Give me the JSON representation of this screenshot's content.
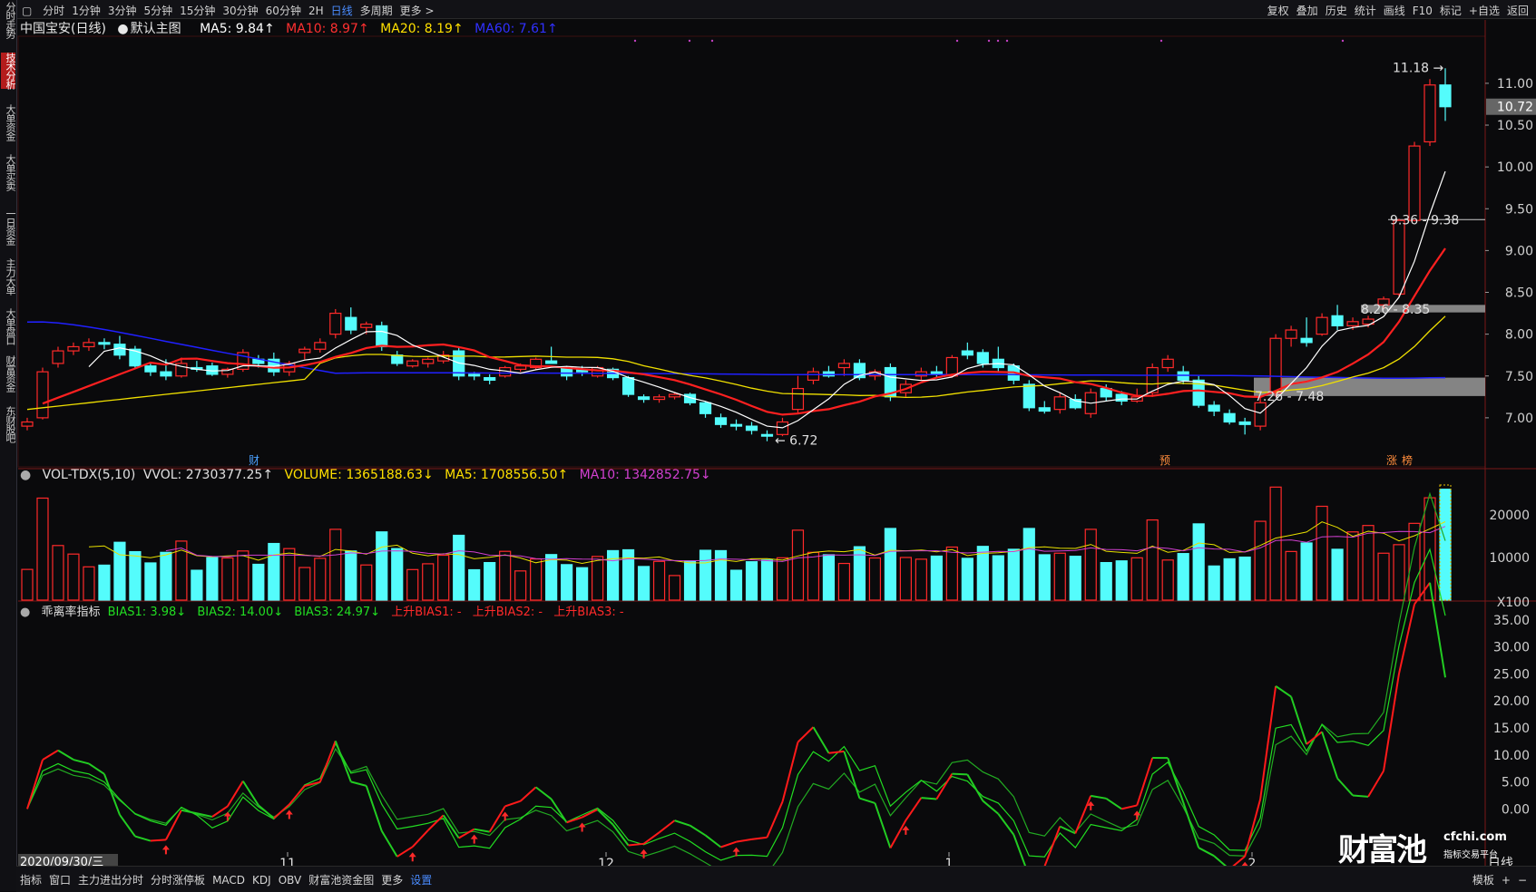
{
  "toolbar": {
    "left": [
      "分时",
      "1分钟",
      "3分钟",
      "5分钟",
      "15分钟",
      "30分钟",
      "60分钟",
      "2H",
      "日线",
      "多周期",
      "更多 >"
    ],
    "active": "日线",
    "right": [
      "复权",
      "叠加",
      "历史",
      "统计",
      "画线",
      "F10",
      "标记",
      "+自选",
      "返回"
    ]
  },
  "sidebar": [
    {
      "label": "分时走势",
      "active": false
    },
    {
      "label": "技术分析",
      "active": true
    },
    {
      "label": "大单资金",
      "active": false
    },
    {
      "label": "大单买卖",
      "active": false
    },
    {
      "label": "一日资金",
      "active": false
    },
    {
      "label": "主力大单",
      "active": false
    },
    {
      "label": "大单盘口",
      "active": false
    },
    {
      "label": "财富资金",
      "active": false
    },
    {
      "label": "东财股吧",
      "active": false
    }
  ],
  "main_legend": {
    "stock": "中国宝安(日线)",
    "template": "默认主图",
    "ma5": "MA5: 9.84↑",
    "ma10": "MA10: 8.97↑",
    "ma20": "MA20: 8.19↑",
    "ma60": "MA60: 7.61↑"
  },
  "vol_legend": {
    "name": "VOL-TDX(5,10)",
    "vvol": "VVOL: 2730377.25↑",
    "volume": "VOLUME: 1365188.63↓",
    "ma5": "MA5: 1708556.50↑",
    "ma10": "MA10: 1342852.75↓"
  },
  "bias_legend": {
    "name": "乖离率指标",
    "bias1": "BIAS1: 3.98↓",
    "bias2": "BIAS2: 14.00↓",
    "bias3": "BIAS3: 24.97↓",
    "up1": "上升BIAS1: -",
    "up2": "上升BIAS2: -",
    "up3": "上升BIAS3: -"
  },
  "price_axis": [
    "11.00",
    "10.50",
    "10.00",
    "9.50",
    "9.00",
    "8.50",
    "8.00",
    "7.50",
    "7.00"
  ],
  "current_price": "10.72",
  "vol_axis": [
    "20000",
    "10000",
    "X100"
  ],
  "bias_axis": [
    "35.00",
    "30.00",
    "25.00",
    "20.00",
    "15.00",
    "10.00",
    "5.00",
    "0.00"
  ],
  "annotations": {
    "high": "11.18",
    "low": "6.72",
    "range1": "9.36 - 9.38",
    "range2": "8.26 - 8.35",
    "range3": "7.26 - 7.48",
    "marker_cai": "财",
    "marker_yu": "预",
    "marker_zhang": "涨",
    "marker_bang": "榜"
  },
  "date_axis": {
    "cursor_date": "2020/09/30/三",
    "months": [
      "11",
      "12",
      "1",
      "2"
    ],
    "period": "日线"
  },
  "bottom_tabs": [
    "指标",
    "窗口",
    "主力进出分时",
    "分时涨停板",
    "MACD",
    "KDJ",
    "OBV",
    "财富池资金图",
    "更多",
    "设置"
  ],
  "bottom_right": [
    "模板",
    "+",
    "−"
  ],
  "watermark": {
    "brand": "财富池",
    "site": "cfchi.com",
    "tagline": "指标交易平台"
  },
  "colors": {
    "up": "#ff2a2a",
    "down": "#54fcfc",
    "ma5": "#ffffff",
    "ma10": "#ff2020",
    "ma20": "#f0e000",
    "ma60": "#2020ff",
    "bias1": "#ff1a1a",
    "bias2": "#22dd22",
    "bias3": "#22aa22",
    "vol_ma10": "#d040d0"
  },
  "chart_data": {
    "type": "candlestick",
    "title": "中国宝安(日线)",
    "ylim": [
      6.5,
      11.4
    ],
    "candles": [
      [
        6.9,
        7.0,
        6.85,
        6.95
      ],
      [
        7.0,
        7.6,
        6.98,
        7.55
      ],
      [
        7.65,
        7.85,
        7.6,
        7.8
      ],
      [
        7.8,
        7.9,
        7.75,
        7.85
      ],
      [
        7.85,
        7.95,
        7.8,
        7.9
      ],
      [
        7.9,
        7.95,
        7.82,
        7.88
      ],
      [
        7.88,
        7.98,
        7.7,
        7.75
      ],
      [
        7.82,
        7.86,
        7.6,
        7.62
      ],
      [
        7.62,
        7.65,
        7.5,
        7.55
      ],
      [
        7.55,
        7.7,
        7.45,
        7.5
      ],
      [
        7.5,
        7.72,
        7.48,
        7.65
      ],
      [
        7.6,
        7.68,
        7.55,
        7.58
      ],
      [
        7.62,
        7.66,
        7.5,
        7.52
      ],
      [
        7.52,
        7.6,
        7.48,
        7.58
      ],
      [
        7.58,
        7.82,
        7.55,
        7.78
      ],
      [
        7.7,
        7.75,
        7.6,
        7.65
      ],
      [
        7.7,
        7.78,
        7.5,
        7.55
      ],
      [
        7.55,
        7.68,
        7.5,
        7.65
      ],
      [
        7.78,
        7.85,
        7.7,
        7.82
      ],
      [
        7.82,
        7.95,
        7.78,
        7.9
      ],
      [
        8.0,
        8.3,
        7.95,
        8.25
      ],
      [
        8.2,
        8.32,
        8.0,
        8.05
      ],
      [
        8.08,
        8.15,
        8.0,
        8.12
      ],
      [
        8.1,
        8.15,
        7.8,
        7.85
      ],
      [
        7.75,
        7.8,
        7.62,
        7.65
      ],
      [
        7.62,
        7.7,
        7.6,
        7.68
      ],
      [
        7.65,
        7.72,
        7.6,
        7.7
      ],
      [
        7.68,
        7.8,
        7.65,
        7.75
      ],
      [
        7.8,
        7.85,
        7.45,
        7.5
      ],
      [
        7.52,
        7.55,
        7.45,
        7.5
      ],
      [
        7.48,
        7.52,
        7.4,
        7.45
      ],
      [
        7.5,
        7.62,
        7.48,
        7.6
      ],
      [
        7.58,
        7.65,
        7.55,
        7.62
      ],
      [
        7.6,
        7.72,
        7.58,
        7.7
      ],
      [
        7.68,
        7.85,
        7.65,
        7.65
      ],
      [
        7.6,
        7.62,
        7.45,
        7.5
      ],
      [
        7.58,
        7.62,
        7.5,
        7.55
      ],
      [
        7.5,
        7.62,
        7.48,
        7.6
      ],
      [
        7.58,
        7.6,
        7.45,
        7.48
      ],
      [
        7.48,
        7.5,
        7.25,
        7.28
      ],
      [
        7.25,
        7.28,
        7.18,
        7.22
      ],
      [
        7.22,
        7.28,
        7.18,
        7.25
      ],
      [
        7.25,
        7.3,
        7.22,
        7.28
      ],
      [
        7.28,
        7.3,
        7.15,
        7.18
      ],
      [
        7.18,
        7.2,
        7.0,
        7.05
      ],
      [
        7.0,
        7.05,
        6.88,
        6.92
      ],
      [
        6.92,
        6.98,
        6.85,
        6.9
      ],
      [
        6.9,
        6.95,
        6.8,
        6.85
      ],
      [
        6.8,
        6.85,
        6.72,
        6.78
      ],
      [
        6.8,
        7.0,
        6.78,
        6.95
      ],
      [
        7.1,
        7.5,
        7.05,
        7.35
      ],
      [
        7.45,
        7.6,
        7.4,
        7.55
      ],
      [
        7.55,
        7.62,
        7.48,
        7.5
      ],
      [
        7.6,
        7.7,
        7.5,
        7.65
      ],
      [
        7.65,
        7.7,
        7.45,
        7.48
      ],
      [
        7.5,
        7.58,
        7.45,
        7.55
      ],
      [
        7.6,
        7.65,
        7.2,
        7.25
      ],
      [
        7.3,
        7.45,
        7.25,
        7.4
      ],
      [
        7.5,
        7.6,
        7.45,
        7.55
      ],
      [
        7.55,
        7.62,
        7.48,
        7.52
      ],
      [
        7.5,
        7.75,
        7.48,
        7.72
      ],
      [
        7.8,
        7.9,
        7.7,
        7.75
      ],
      [
        7.78,
        7.82,
        7.6,
        7.65
      ],
      [
        7.7,
        7.85,
        7.55,
        7.6
      ],
      [
        7.62,
        7.65,
        7.4,
        7.45
      ],
      [
        7.4,
        7.45,
        7.08,
        7.12
      ],
      [
        7.12,
        7.2,
        7.05,
        7.08
      ],
      [
        7.1,
        7.3,
        7.05,
        7.25
      ],
      [
        7.22,
        7.28,
        7.1,
        7.12
      ],
      [
        7.05,
        7.35,
        7.0,
        7.3
      ],
      [
        7.35,
        7.4,
        7.2,
        7.25
      ],
      [
        7.28,
        7.32,
        7.15,
        7.2
      ],
      [
        7.2,
        7.35,
        7.18,
        7.25
      ],
      [
        7.3,
        7.65,
        7.25,
        7.6
      ],
      [
        7.6,
        7.75,
        7.55,
        7.7
      ],
      [
        7.55,
        7.62,
        7.4,
        7.45
      ],
      [
        7.45,
        7.5,
        7.12,
        7.15
      ],
      [
        7.15,
        7.2,
        7.02,
        7.08
      ],
      [
        7.05,
        7.1,
        6.92,
        6.95
      ],
      [
        6.95,
        7.0,
        6.8,
        6.92
      ],
      [
        6.9,
        7.25,
        6.85,
        7.18
      ],
      [
        7.3,
        8.0,
        7.25,
        7.95
      ],
      [
        7.95,
        8.1,
        7.85,
        8.05
      ],
      [
        7.95,
        8.2,
        7.85,
        7.9
      ],
      [
        8.0,
        8.25,
        7.98,
        8.2
      ],
      [
        8.22,
        8.35,
        8.05,
        8.1
      ],
      [
        8.1,
        8.2,
        8.05,
        8.15
      ],
      [
        8.12,
        8.22,
        8.08,
        8.18
      ],
      [
        8.35,
        8.45,
        8.3,
        8.42
      ],
      [
        8.48,
        9.38,
        8.45,
        9.36
      ],
      [
        9.36,
        10.3,
        9.35,
        10.25
      ],
      [
        10.3,
        11.05,
        10.25,
        10.98
      ],
      [
        10.98,
        11.18,
        10.55,
        10.72
      ]
    ],
    "ma5_last": 9.84,
    "ma10_last": 8.97,
    "ma20_last": 8.19,
    "ma60_last": 7.61,
    "volume": {
      "ylim": [
        0,
        27000
      ],
      "ma5_last": 1708556.5,
      "ma10_last": 1342852.75
    },
    "bias": {
      "ylim": [
        -8,
        37
      ],
      "bias1_last": 3.98,
      "bias2_last": 14.0,
      "bias3_last": 24.97
    }
  }
}
